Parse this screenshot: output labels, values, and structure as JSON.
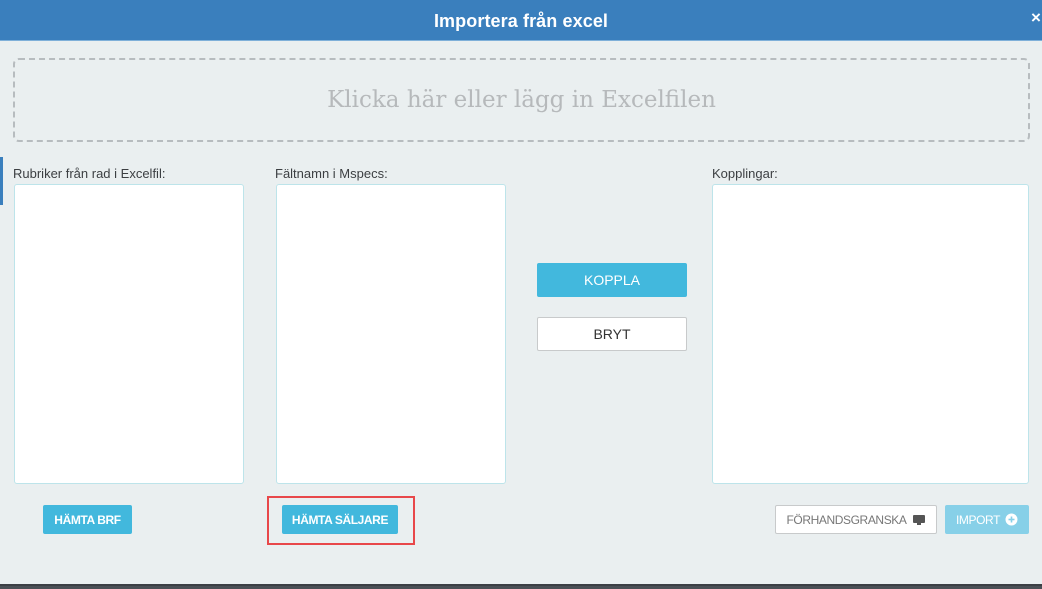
{
  "dialog": {
    "title": "Importera från excel",
    "close_glyph": "×"
  },
  "dropzone": {
    "text": "Klicka här eller lägg in Excelfilen"
  },
  "columns": {
    "excel_headers_label": "Rubriker från rad i Excelfil:",
    "mspecs_fields_label": "Fältnamn i Mspecs:",
    "mappings_label": "Kopplingar:"
  },
  "actions": {
    "connect_label": "KOPPLA",
    "disconnect_label": "BRYT",
    "fetch_brf_label": "HÄMTA BRF",
    "fetch_sellers_label": "HÄMTA SÄLJARE",
    "preview_label": "FÖRHANDSGRANSKA",
    "import_label": "IMPORT"
  },
  "icons": {
    "preview": "monitor-icon",
    "import": "plus-circle-icon",
    "close": "close-icon"
  },
  "colors": {
    "titlebar": "#3a7fbd",
    "primary_button": "#42b8dd",
    "import_disabled": "#87d0e8",
    "highlight": "#e8484a"
  }
}
